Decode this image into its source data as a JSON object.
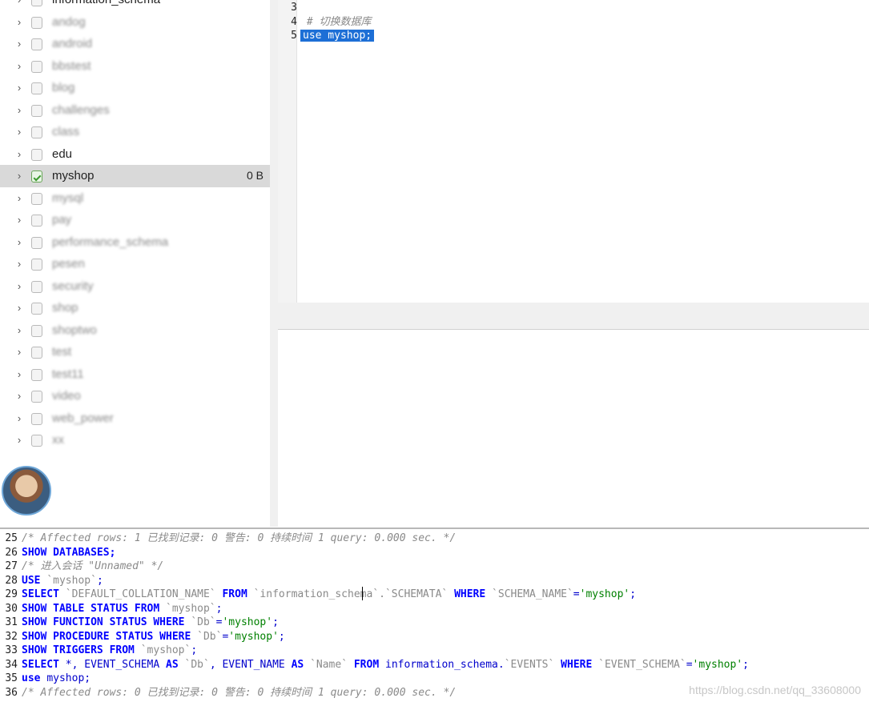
{
  "db_tree": {
    "items": [
      {
        "label": "information_schema",
        "blurred": false,
        "active": false,
        "selected": false,
        "size": ""
      },
      {
        "label": "andog",
        "blurred": true,
        "active": false,
        "selected": false,
        "size": ""
      },
      {
        "label": "android",
        "blurred": true,
        "active": false,
        "selected": false,
        "size": ""
      },
      {
        "label": "bbstest",
        "blurred": true,
        "active": false,
        "selected": false,
        "size": ""
      },
      {
        "label": "blog",
        "blurred": true,
        "active": false,
        "selected": false,
        "size": ""
      },
      {
        "label": "challenges",
        "blurred": true,
        "active": false,
        "selected": false,
        "size": ""
      },
      {
        "label": "class",
        "blurred": true,
        "active": false,
        "selected": false,
        "size": ""
      },
      {
        "label": "edu",
        "blurred": false,
        "active": false,
        "selected": false,
        "size": ""
      },
      {
        "label": "myshop",
        "blurred": false,
        "active": true,
        "selected": true,
        "size": "0 B"
      },
      {
        "label": "mysql",
        "blurred": true,
        "active": false,
        "selected": false,
        "size": ""
      },
      {
        "label": "pay",
        "blurred": true,
        "active": false,
        "selected": false,
        "size": ""
      },
      {
        "label": "performance_schema",
        "blurred": true,
        "active": false,
        "selected": false,
        "size": ""
      },
      {
        "label": "pesen",
        "blurred": true,
        "active": false,
        "selected": false,
        "size": ""
      },
      {
        "label": "security",
        "blurred": true,
        "active": false,
        "selected": false,
        "size": ""
      },
      {
        "label": "shop",
        "blurred": true,
        "active": false,
        "selected": false,
        "size": ""
      },
      {
        "label": "shoptwo",
        "blurred": true,
        "active": false,
        "selected": false,
        "size": ""
      },
      {
        "label": "test",
        "blurred": true,
        "active": false,
        "selected": false,
        "size": ""
      },
      {
        "label": "test11",
        "blurred": true,
        "active": false,
        "selected": false,
        "size": ""
      },
      {
        "label": "video",
        "blurred": true,
        "active": false,
        "selected": false,
        "size": ""
      },
      {
        "label": "web_power",
        "blurred": true,
        "active": false,
        "selected": false,
        "size": ""
      },
      {
        "label": "xx",
        "blurred": true,
        "active": false,
        "selected": false,
        "size": ""
      }
    ]
  },
  "editor": {
    "lines": [
      {
        "num": "3",
        "text": "",
        "type": "plain"
      },
      {
        "num": "4",
        "text": " # 切换数据库",
        "type": "comment"
      },
      {
        "num": "5",
        "text": "use myshop;",
        "type": "selected"
      }
    ]
  },
  "query_log": {
    "lines": [
      {
        "num": "25",
        "parts": [
          {
            "t": "/* Affected rows: 1  已找到记录: 0  警告: 0  持续时间 1 query: 0.000 sec. */",
            "c": "cm"
          }
        ]
      },
      {
        "num": "26",
        "parts": [
          {
            "t": "SHOW DATABASES;",
            "c": "kw"
          }
        ]
      },
      {
        "num": "27",
        "parts": [
          {
            "t": "/* 进入会话 \"Unnamed\" */",
            "c": "cm"
          }
        ]
      },
      {
        "num": "28",
        "parts": [
          {
            "t": "USE ",
            "c": "kw"
          },
          {
            "t": "`myshop`",
            "c": "id"
          },
          {
            "t": ";",
            "c": "code"
          }
        ]
      },
      {
        "num": "29",
        "parts": [
          {
            "t": "SELECT ",
            "c": "kw"
          },
          {
            "t": "`DEFAULT_COLLATION_NAME`",
            "c": "id"
          },
          {
            "t": " FROM ",
            "c": "kw"
          },
          {
            "t": "`information_schema`.`SCHEMATA`",
            "c": "id"
          },
          {
            "t": " WHERE ",
            "c": "kw"
          },
          {
            "t": "`SCHEMA_NAME`",
            "c": "id"
          },
          {
            "t": "=",
            "c": "code"
          },
          {
            "t": "'myshop'",
            "c": "str"
          },
          {
            "t": ";",
            "c": "code"
          }
        ]
      },
      {
        "num": "30",
        "parts": [
          {
            "t": "SHOW TABLE STATUS FROM ",
            "c": "kw"
          },
          {
            "t": "`myshop`",
            "c": "id"
          },
          {
            "t": ";",
            "c": "code"
          }
        ]
      },
      {
        "num": "31",
        "parts": [
          {
            "t": "SHOW FUNCTION STATUS WHERE ",
            "c": "kw"
          },
          {
            "t": "`Db`",
            "c": "id"
          },
          {
            "t": "=",
            "c": "code"
          },
          {
            "t": "'myshop'",
            "c": "str"
          },
          {
            "t": ";",
            "c": "code"
          }
        ]
      },
      {
        "num": "32",
        "parts": [
          {
            "t": "SHOW PROCEDURE STATUS WHERE ",
            "c": "kw"
          },
          {
            "t": "`Db`",
            "c": "id"
          },
          {
            "t": "=",
            "c": "code"
          },
          {
            "t": "'myshop'",
            "c": "str"
          },
          {
            "t": ";",
            "c": "code"
          }
        ]
      },
      {
        "num": "33",
        "parts": [
          {
            "t": "SHOW TRIGGERS FROM ",
            "c": "kw"
          },
          {
            "t": "`myshop`",
            "c": "id"
          },
          {
            "t": ";",
            "c": "code"
          }
        ]
      },
      {
        "num": "34",
        "parts": [
          {
            "t": "SELECT ",
            "c": "kw"
          },
          {
            "t": "*, EVENT_SCHEMA ",
            "c": "code"
          },
          {
            "t": "AS ",
            "c": "kw"
          },
          {
            "t": "`Db`",
            "c": "id"
          },
          {
            "t": ", EVENT_NAME ",
            "c": "code"
          },
          {
            "t": "AS ",
            "c": "kw"
          },
          {
            "t": "`Name`",
            "c": "id"
          },
          {
            "t": " FROM ",
            "c": "kw"
          },
          {
            "t": "information_schema.",
            "c": "code"
          },
          {
            "t": "`EVENTS`",
            "c": "id"
          },
          {
            "t": " WHERE ",
            "c": "kw"
          },
          {
            "t": "`EVENT_SCHEMA`",
            "c": "id"
          },
          {
            "t": "=",
            "c": "code"
          },
          {
            "t": "'myshop'",
            "c": "str"
          },
          {
            "t": ";",
            "c": "code"
          }
        ]
      },
      {
        "num": "35",
        "parts": [
          {
            "t": "use ",
            "c": "kw"
          },
          {
            "t": "myshop;",
            "c": "code"
          }
        ]
      },
      {
        "num": "36",
        "parts": [
          {
            "t": "/* Affected rows: 0  已找到记录: 0  警告: 0  持续时间 1 query: 0.000 sec. */",
            "c": "cm"
          }
        ]
      }
    ]
  },
  "watermark": "https://blog.csdn.net/qq_33608000"
}
